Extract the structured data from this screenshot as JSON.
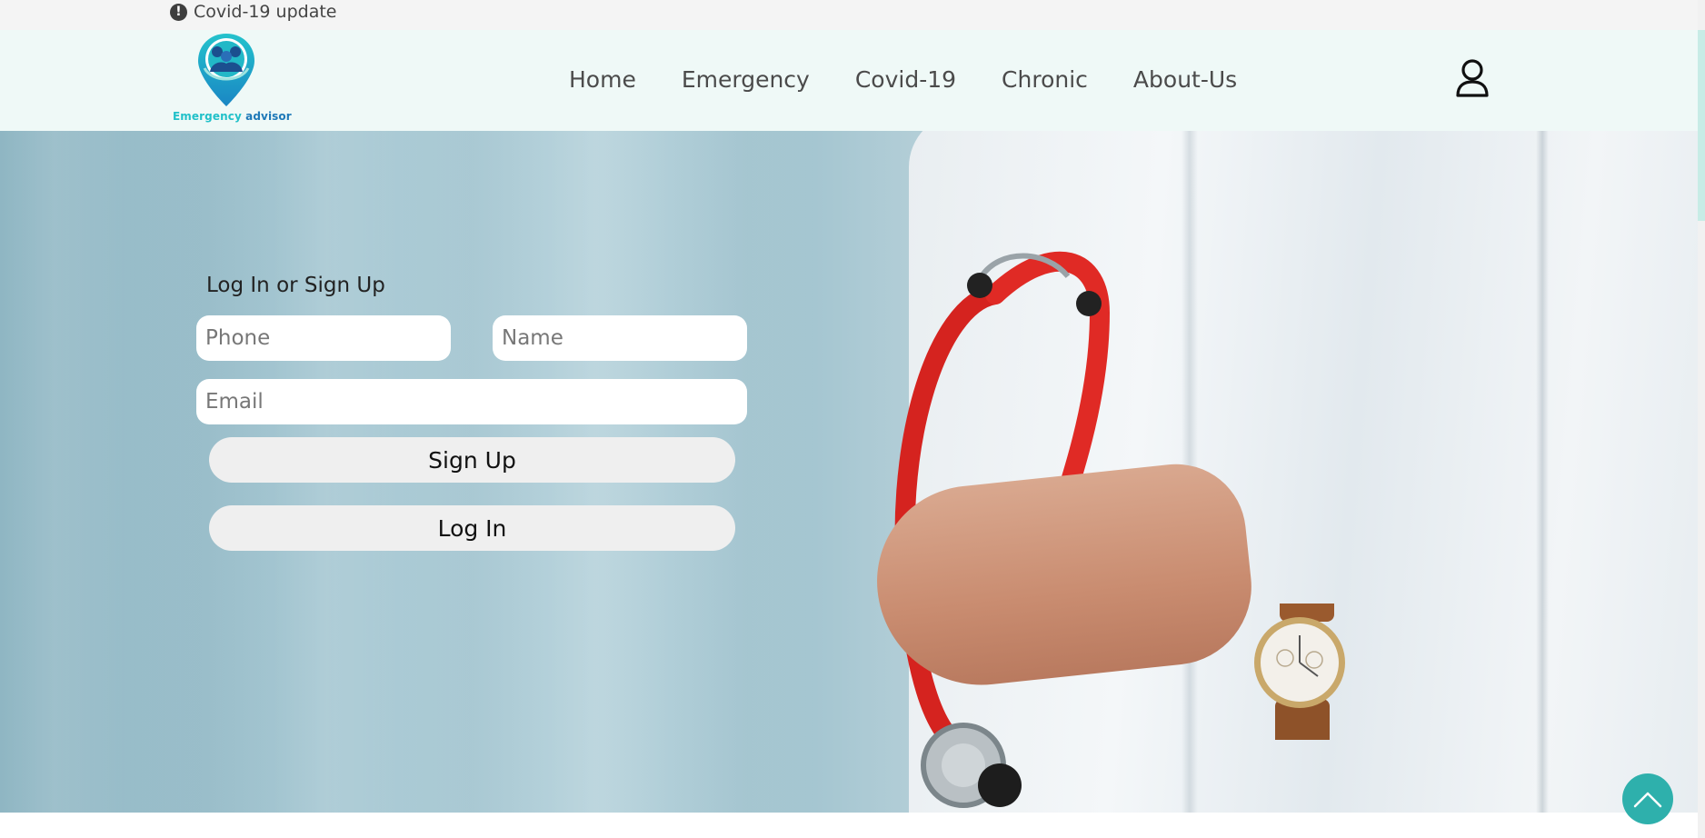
{
  "topbar": {
    "notice_label": "Covid-19 update",
    "notice_icon": "exclamation-circle-icon"
  },
  "brand": {
    "name_part1": "Emergency",
    "name_part2": "advisor",
    "colors": {
      "teal": "#22c1c9",
      "blue": "#1e79b8"
    }
  },
  "nav": {
    "items": [
      "Home",
      "Emergency",
      "Covid-19",
      "Chronic",
      "About-Us"
    ]
  },
  "header": {
    "user_icon": "user-icon"
  },
  "form": {
    "title": "Log In or Sign Up",
    "phone_placeholder": "Phone",
    "name_placeholder": "Name",
    "email_placeholder": "Email",
    "signup_label": "Sign Up",
    "login_label": "Log In"
  },
  "scroll_top": {
    "icon": "chevron-up-icon",
    "color": "#2eb0ac"
  }
}
